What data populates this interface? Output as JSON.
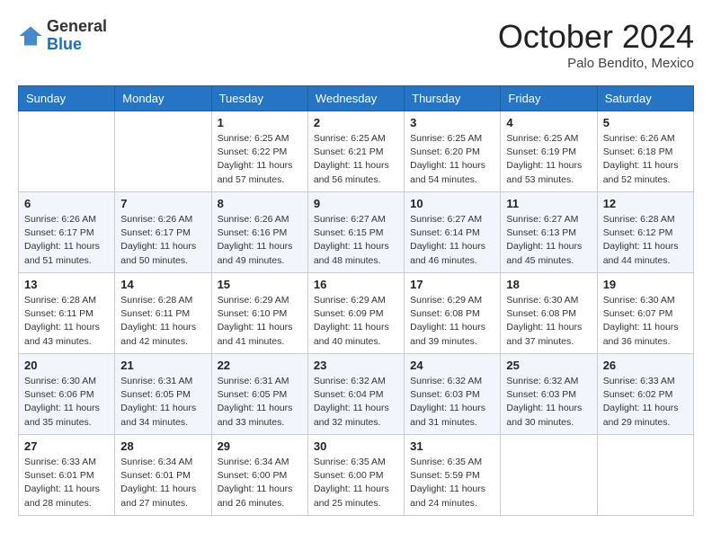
{
  "header": {
    "logo": {
      "general": "General",
      "blue": "Blue"
    },
    "month": "October 2024",
    "location": "Palo Bendito, Mexico"
  },
  "weekdays": [
    "Sunday",
    "Monday",
    "Tuesday",
    "Wednesday",
    "Thursday",
    "Friday",
    "Saturday"
  ],
  "weeks": [
    [
      null,
      null,
      {
        "day": 1,
        "sunrise": "Sunrise: 6:25 AM",
        "sunset": "Sunset: 6:22 PM",
        "daylight": "Daylight: 11 hours and 57 minutes."
      },
      {
        "day": 2,
        "sunrise": "Sunrise: 6:25 AM",
        "sunset": "Sunset: 6:21 PM",
        "daylight": "Daylight: 11 hours and 56 minutes."
      },
      {
        "day": 3,
        "sunrise": "Sunrise: 6:25 AM",
        "sunset": "Sunset: 6:20 PM",
        "daylight": "Daylight: 11 hours and 54 minutes."
      },
      {
        "day": 4,
        "sunrise": "Sunrise: 6:25 AM",
        "sunset": "Sunset: 6:19 PM",
        "daylight": "Daylight: 11 hours and 53 minutes."
      },
      {
        "day": 5,
        "sunrise": "Sunrise: 6:26 AM",
        "sunset": "Sunset: 6:18 PM",
        "daylight": "Daylight: 11 hours and 52 minutes."
      }
    ],
    [
      {
        "day": 6,
        "sunrise": "Sunrise: 6:26 AM",
        "sunset": "Sunset: 6:17 PM",
        "daylight": "Daylight: 11 hours and 51 minutes."
      },
      {
        "day": 7,
        "sunrise": "Sunrise: 6:26 AM",
        "sunset": "Sunset: 6:17 PM",
        "daylight": "Daylight: 11 hours and 50 minutes."
      },
      {
        "day": 8,
        "sunrise": "Sunrise: 6:26 AM",
        "sunset": "Sunset: 6:16 PM",
        "daylight": "Daylight: 11 hours and 49 minutes."
      },
      {
        "day": 9,
        "sunrise": "Sunrise: 6:27 AM",
        "sunset": "Sunset: 6:15 PM",
        "daylight": "Daylight: 11 hours and 48 minutes."
      },
      {
        "day": 10,
        "sunrise": "Sunrise: 6:27 AM",
        "sunset": "Sunset: 6:14 PM",
        "daylight": "Daylight: 11 hours and 46 minutes."
      },
      {
        "day": 11,
        "sunrise": "Sunrise: 6:27 AM",
        "sunset": "Sunset: 6:13 PM",
        "daylight": "Daylight: 11 hours and 45 minutes."
      },
      {
        "day": 12,
        "sunrise": "Sunrise: 6:28 AM",
        "sunset": "Sunset: 6:12 PM",
        "daylight": "Daylight: 11 hours and 44 minutes."
      }
    ],
    [
      {
        "day": 13,
        "sunrise": "Sunrise: 6:28 AM",
        "sunset": "Sunset: 6:11 PM",
        "daylight": "Daylight: 11 hours and 43 minutes."
      },
      {
        "day": 14,
        "sunrise": "Sunrise: 6:28 AM",
        "sunset": "Sunset: 6:11 PM",
        "daylight": "Daylight: 11 hours and 42 minutes."
      },
      {
        "day": 15,
        "sunrise": "Sunrise: 6:29 AM",
        "sunset": "Sunset: 6:10 PM",
        "daylight": "Daylight: 11 hours and 41 minutes."
      },
      {
        "day": 16,
        "sunrise": "Sunrise: 6:29 AM",
        "sunset": "Sunset: 6:09 PM",
        "daylight": "Daylight: 11 hours and 40 minutes."
      },
      {
        "day": 17,
        "sunrise": "Sunrise: 6:29 AM",
        "sunset": "Sunset: 6:08 PM",
        "daylight": "Daylight: 11 hours and 39 minutes."
      },
      {
        "day": 18,
        "sunrise": "Sunrise: 6:30 AM",
        "sunset": "Sunset: 6:08 PM",
        "daylight": "Daylight: 11 hours and 37 minutes."
      },
      {
        "day": 19,
        "sunrise": "Sunrise: 6:30 AM",
        "sunset": "Sunset: 6:07 PM",
        "daylight": "Daylight: 11 hours and 36 minutes."
      }
    ],
    [
      {
        "day": 20,
        "sunrise": "Sunrise: 6:30 AM",
        "sunset": "Sunset: 6:06 PM",
        "daylight": "Daylight: 11 hours and 35 minutes."
      },
      {
        "day": 21,
        "sunrise": "Sunrise: 6:31 AM",
        "sunset": "Sunset: 6:05 PM",
        "daylight": "Daylight: 11 hours and 34 minutes."
      },
      {
        "day": 22,
        "sunrise": "Sunrise: 6:31 AM",
        "sunset": "Sunset: 6:05 PM",
        "daylight": "Daylight: 11 hours and 33 minutes."
      },
      {
        "day": 23,
        "sunrise": "Sunrise: 6:32 AM",
        "sunset": "Sunset: 6:04 PM",
        "daylight": "Daylight: 11 hours and 32 minutes."
      },
      {
        "day": 24,
        "sunrise": "Sunrise: 6:32 AM",
        "sunset": "Sunset: 6:03 PM",
        "daylight": "Daylight: 11 hours and 31 minutes."
      },
      {
        "day": 25,
        "sunrise": "Sunrise: 6:32 AM",
        "sunset": "Sunset: 6:03 PM",
        "daylight": "Daylight: 11 hours and 30 minutes."
      },
      {
        "day": 26,
        "sunrise": "Sunrise: 6:33 AM",
        "sunset": "Sunset: 6:02 PM",
        "daylight": "Daylight: 11 hours and 29 minutes."
      }
    ],
    [
      {
        "day": 27,
        "sunrise": "Sunrise: 6:33 AM",
        "sunset": "Sunset: 6:01 PM",
        "daylight": "Daylight: 11 hours and 28 minutes."
      },
      {
        "day": 28,
        "sunrise": "Sunrise: 6:34 AM",
        "sunset": "Sunset: 6:01 PM",
        "daylight": "Daylight: 11 hours and 27 minutes."
      },
      {
        "day": 29,
        "sunrise": "Sunrise: 6:34 AM",
        "sunset": "Sunset: 6:00 PM",
        "daylight": "Daylight: 11 hours and 26 minutes."
      },
      {
        "day": 30,
        "sunrise": "Sunrise: 6:35 AM",
        "sunset": "Sunset: 6:00 PM",
        "daylight": "Daylight: 11 hours and 25 minutes."
      },
      {
        "day": 31,
        "sunrise": "Sunrise: 6:35 AM",
        "sunset": "Sunset: 5:59 PM",
        "daylight": "Daylight: 11 hours and 24 minutes."
      },
      null,
      null
    ]
  ]
}
